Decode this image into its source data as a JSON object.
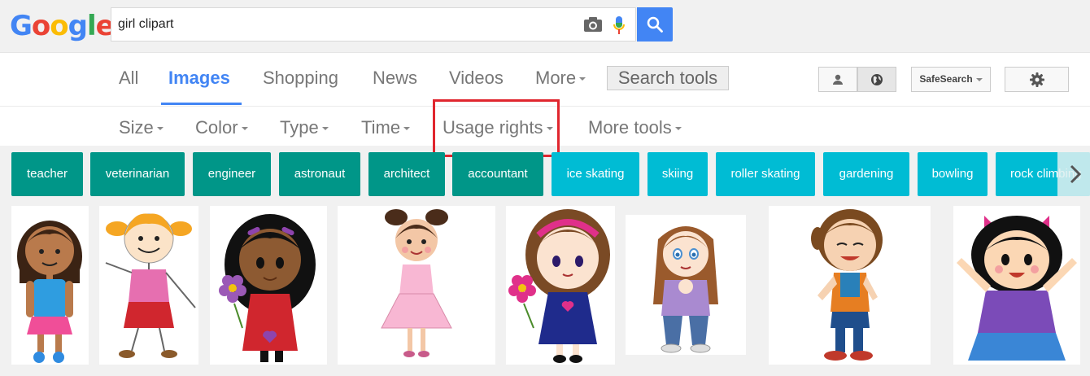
{
  "search": {
    "logo_letters": [
      "G",
      "o",
      "o",
      "g",
      "l",
      "e"
    ],
    "query": "girl clipart"
  },
  "nav": {
    "tabs": [
      {
        "label": "All"
      },
      {
        "label": "Images"
      },
      {
        "label": "Shopping"
      },
      {
        "label": "News"
      },
      {
        "label": "Videos"
      },
      {
        "label": "More"
      }
    ],
    "search_tools_label": "Search tools",
    "safesearch_label": "SafeSearch"
  },
  "tools": {
    "items": [
      {
        "label": "Size"
      },
      {
        "label": "Color"
      },
      {
        "label": "Type"
      },
      {
        "label": "Time"
      },
      {
        "label": "Usage rights"
      },
      {
        "label": "More tools"
      }
    ]
  },
  "chips": [
    {
      "label": "teacher"
    },
    {
      "label": "veterinarian"
    },
    {
      "label": "engineer"
    },
    {
      "label": "astronaut"
    },
    {
      "label": "architect"
    },
    {
      "label": "accountant"
    },
    {
      "label": "ice skating"
    },
    {
      "label": "skiing"
    },
    {
      "label": "roller skating"
    },
    {
      "label": "gardening"
    },
    {
      "label": "bowling"
    },
    {
      "label": "rock climbing"
    }
  ],
  "colors": {
    "accent_blue": "#4285f4",
    "chip_teal": "#009688",
    "chip_cyan": "#00bcd4",
    "highlight_red": "#e0262e"
  },
  "icons": [
    "camera-icon",
    "microphone-icon",
    "search-icon",
    "person-icon",
    "globe-icon",
    "gear-icon",
    "chevron-right-icon"
  ]
}
